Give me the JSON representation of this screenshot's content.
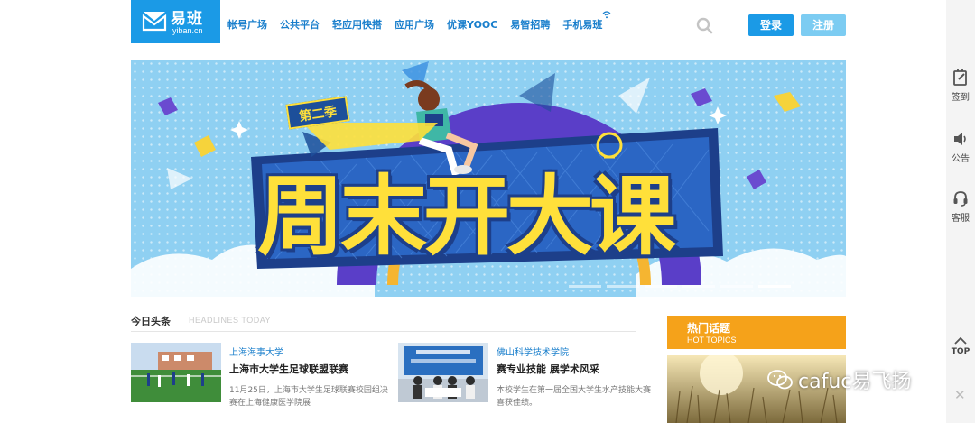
{
  "header": {
    "logo": {
      "name": "易班",
      "domain": "yiban.cn"
    },
    "nav": [
      "帐号广场",
      "公共平台",
      "轻应用快搭",
      "应用广场",
      "优课YOOC",
      "易智招聘",
      "手机易班"
    ],
    "login_label": "登录",
    "register_label": "注册"
  },
  "sidebar": {
    "items": [
      {
        "label": "签到",
        "icon": "checkin-icon"
      },
      {
        "label": "公告",
        "icon": "announcement-icon"
      },
      {
        "label": "客服",
        "icon": "headset-icon"
      },
      {
        "label": "TOP",
        "icon": "chevron-up-icon"
      }
    ],
    "close_glyph": "✕"
  },
  "banner": {
    "season": "第二季",
    "title": "周末开大课",
    "slides": 6,
    "active_slide": 6
  },
  "headlines": {
    "title": "今日头条",
    "subtitle": "HEADLINES TODAY",
    "items": [
      {
        "school": "上海海事大学",
        "headline": "上海市大学生足球联盟联赛",
        "excerpt": "11月25日，上海市大学生足球联赛校园组决赛在上海健康医学院展"
      },
      {
        "school": "佛山科学技术学院",
        "headline": "赛专业技能 展学术风采",
        "excerpt": "本校学生在第一届全国大学生水产技能大赛喜获佳绩。"
      }
    ]
  },
  "hot_topics": {
    "title": "热门话题",
    "subtitle": "HOT TOPICS"
  },
  "watermark": {
    "text": "cafuc易飞扬"
  },
  "colors": {
    "brand_blue": "#1b9ae6",
    "register_blue": "#7cccf2",
    "hot_orange": "#f5a21a",
    "banner_yellow": "#ffe03a",
    "banner_navy": "#1d3f8a"
  }
}
